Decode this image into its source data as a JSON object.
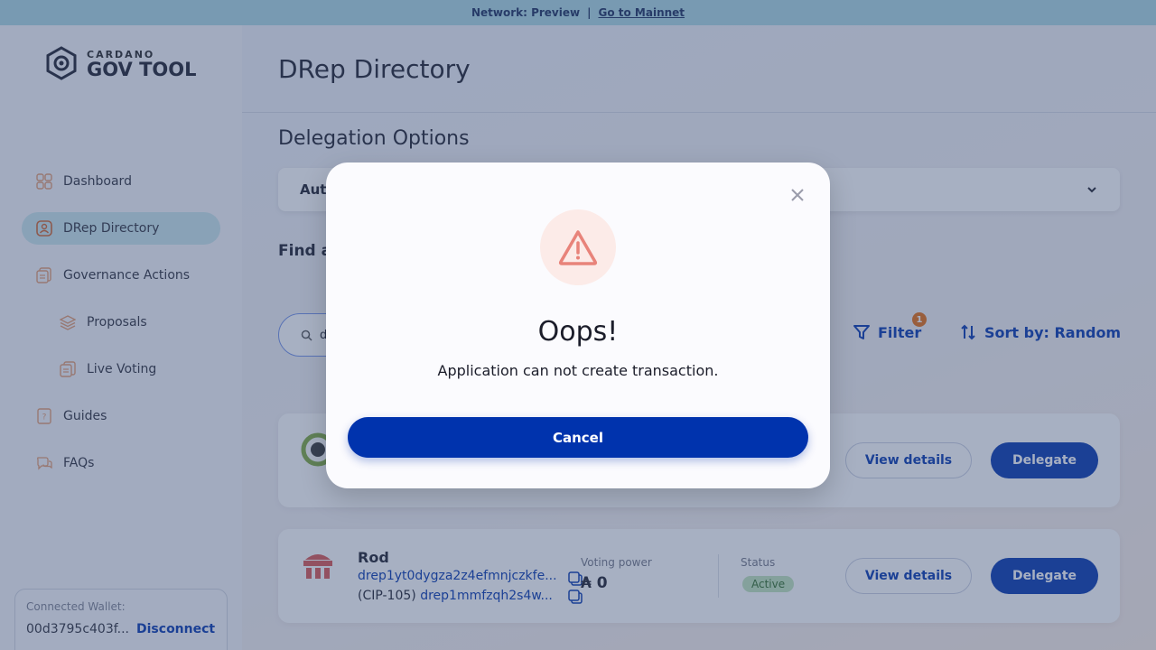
{
  "banner": {
    "network_text": "Network: Preview",
    "separator": "|",
    "link_text": "Go to Mainnet"
  },
  "logo": {
    "small": "CARDANO",
    "big": "GOV TOOL"
  },
  "sidebar": {
    "items": [
      {
        "label": "Dashboard",
        "icon": "dashboard-icon",
        "active": false
      },
      {
        "label": "DRep Directory",
        "icon": "drep-directory-icon",
        "active": true
      },
      {
        "label": "Governance Actions",
        "icon": "governance-actions-icon",
        "active": false
      },
      {
        "label": "Proposals",
        "icon": "proposals-icon",
        "active": false,
        "sub": true
      },
      {
        "label": "Live Voting",
        "icon": "live-voting-icon",
        "active": false,
        "sub": true
      },
      {
        "label": "Guides",
        "icon": "guides-icon",
        "active": false
      },
      {
        "label": "FAQs",
        "icon": "faqs-icon",
        "active": false
      }
    ],
    "wallet": {
      "label": "Connected Wallet:",
      "address": "00d3795c403f...",
      "disconnect": "Disconnect"
    }
  },
  "main": {
    "title": "DRep Directory",
    "delegation_title": "Delegation Options",
    "delegation_select": "Aut",
    "find_title": "Find a",
    "search_value": "d",
    "filter_label": "Filter",
    "filter_count": "1",
    "sort_label": "Sort by: Random",
    "cards": [
      {
        "name": "",
        "id": "",
        "cip_label": "",
        "cip_value": "",
        "voting_power_label": "",
        "voting_power": "",
        "status_label": "",
        "status": "",
        "view_details": "View details",
        "delegate": "Delegate"
      },
      {
        "name": "Rod",
        "id": "drep1yt0dygza2z4efmnjczkfe...",
        "cip_label": "(CIP-105)",
        "cip_value": "drep1mmfzqh2s4w...",
        "voting_power_label": "Voting power",
        "voting_power": "₳ 0",
        "status_label": "Status",
        "status": "Active",
        "view_details": "View details",
        "delegate": "Delegate"
      }
    ]
  },
  "modal": {
    "title": "Oops!",
    "message": "Application can not create transaction.",
    "cancel_label": "Cancel"
  },
  "colors": {
    "primary": "#0033ad",
    "banner": "#a9d8e2",
    "active_nav": "#c9e6ec",
    "warning": "#e8837a",
    "warning_bg": "#fcebe8",
    "status_active_bg": "#c0e4ba",
    "filter_badge": "#e66b0c"
  }
}
